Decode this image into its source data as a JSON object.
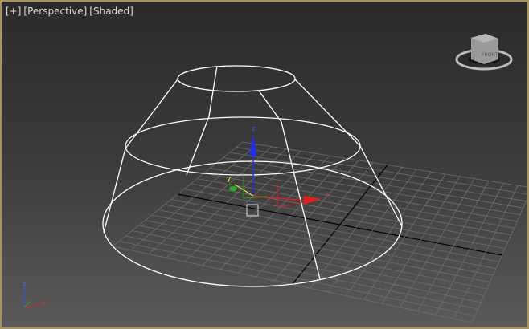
{
  "viewport": {
    "menus": [
      "[+]",
      "[Perspective]",
      "[Shaded]"
    ],
    "viewcube_face": "FRONT",
    "gizmo_axes": {
      "x": "x",
      "y": "y",
      "z": "z"
    },
    "triad_axes": {
      "x": "x",
      "z": "z"
    }
  },
  "colors": {
    "frame": "#a8935a",
    "wire": "#ffffff",
    "x_axis": "#e02020",
    "y_axis": "#20b020",
    "z_axis": "#2030e0"
  }
}
